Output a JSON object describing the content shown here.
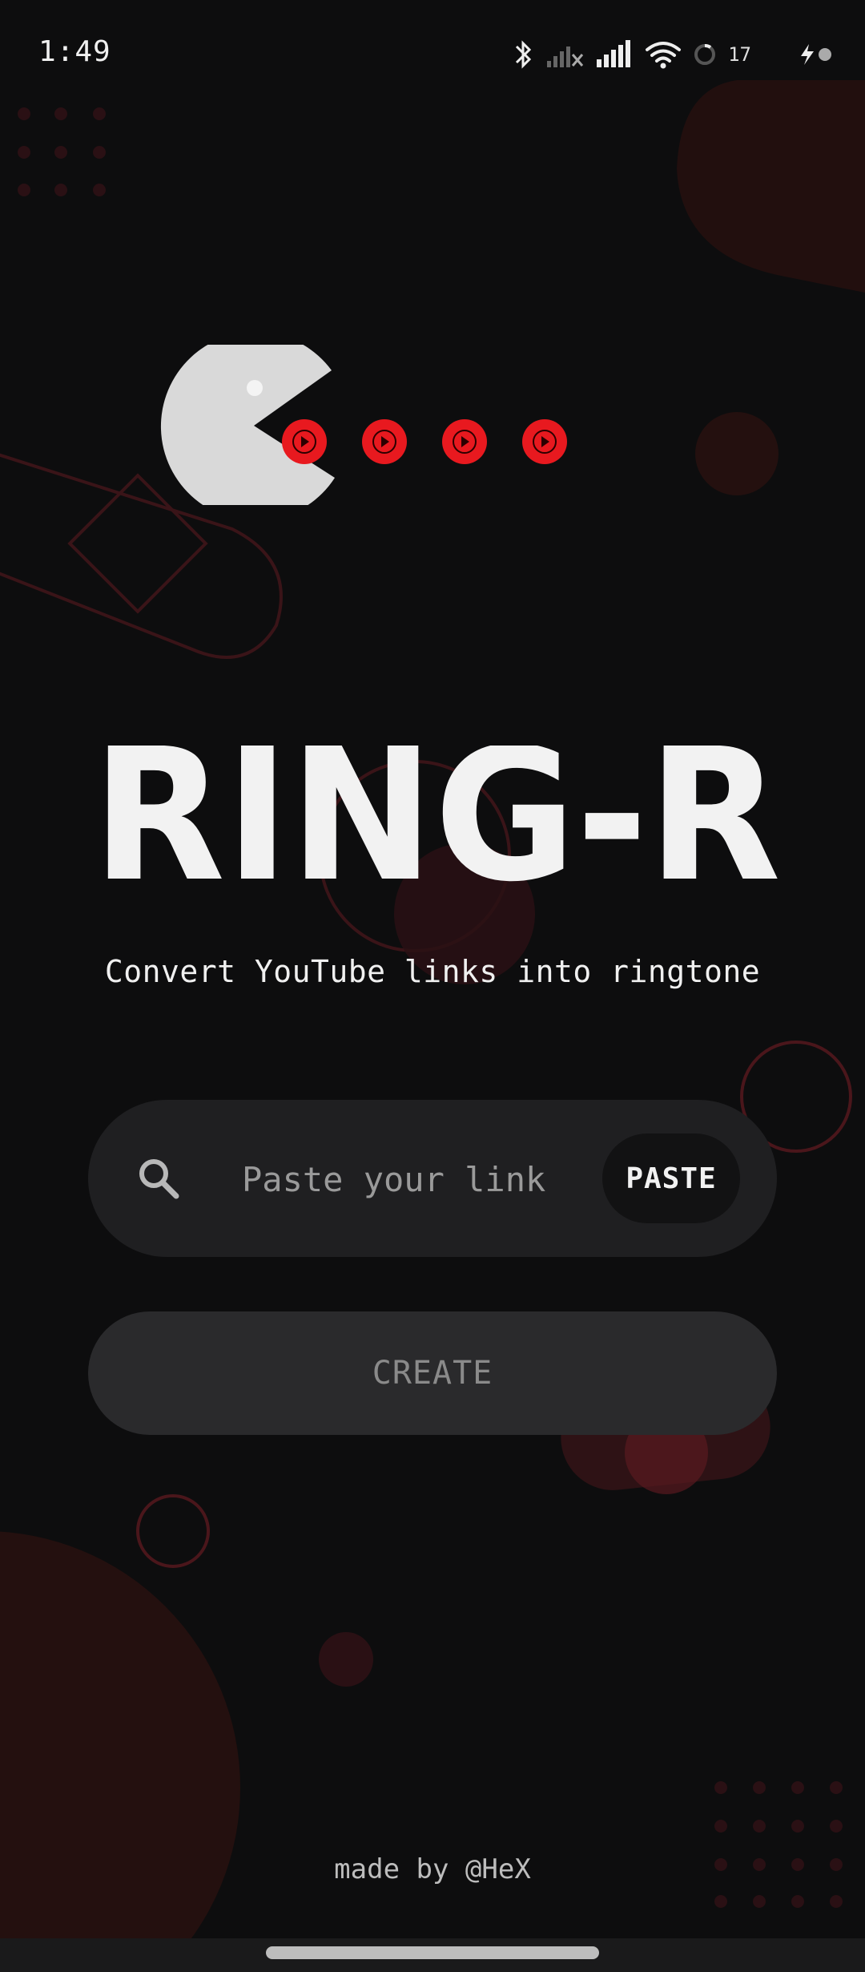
{
  "status_bar": {
    "time": "1:49",
    "battery_level": "17",
    "icons": [
      "bluetooth-icon",
      "cellular-no-signal-icon",
      "cellular-signal-icon",
      "wifi-icon",
      "battery-ring-icon",
      "charging-icon"
    ]
  },
  "app": {
    "logo_text": "RING-R",
    "tagline": "Convert YouTube links into ringtone"
  },
  "search": {
    "placeholder": "Paste your link",
    "value": "",
    "paste_label": "PASTE"
  },
  "create_label": "CREATE",
  "footer": "made by @HeX",
  "colors": {
    "background": "#0d0d0e",
    "accent_red": "#e8191f",
    "deco_red": "#2a1014",
    "pacman": "#d9d9d9"
  }
}
